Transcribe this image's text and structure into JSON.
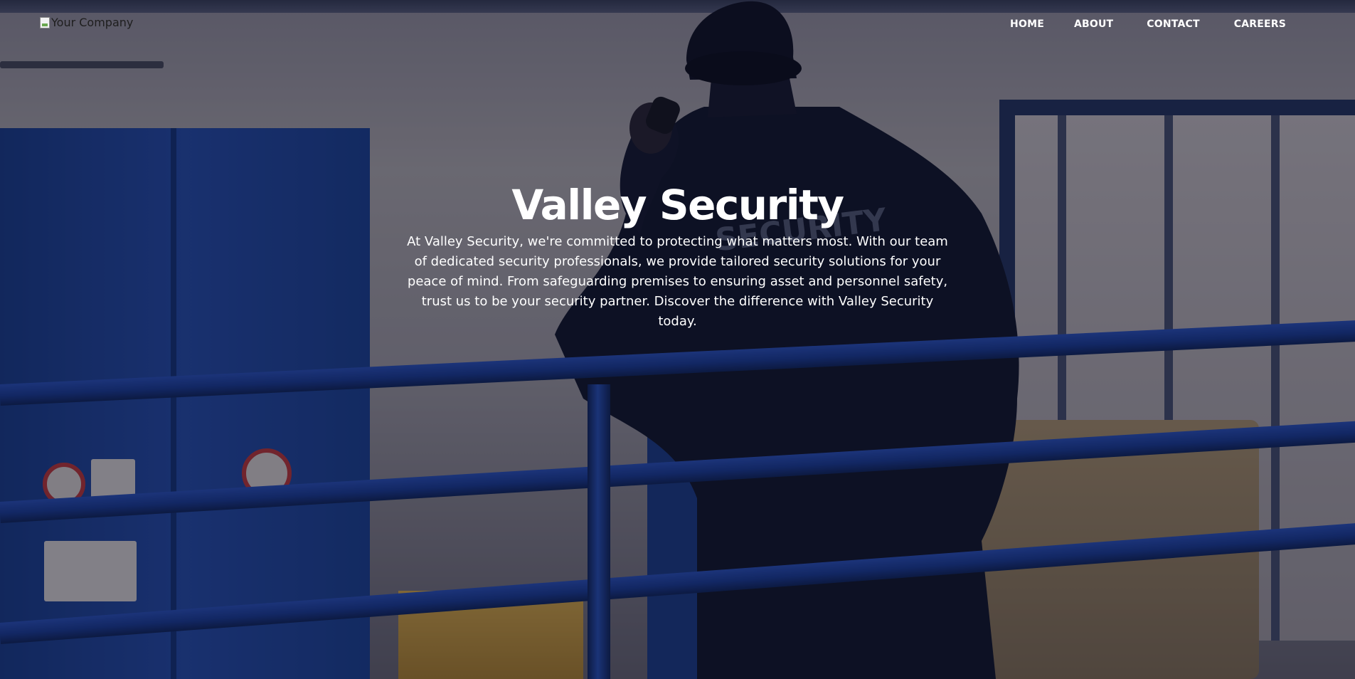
{
  "header": {
    "logo_alt": "Your Company",
    "nav": [
      "HOME",
      "ABOUT",
      "CONTACT",
      "CAREERS"
    ]
  },
  "hero": {
    "title": "Valley Security",
    "description": "At Valley Security, we're committed to protecting what matters most. With our team of dedicated security professionals, we provide tailored security solutions for your peace of mind. From safeguarding premises to ensuring asset and personnel safety, trust us to be your security partner. Discover the difference with Valley Security today.",
    "jacket_print": "SECURITY"
  },
  "colors": {
    "nav_text": "#ffffff",
    "hero_text": "#ffffff",
    "overlay": "rgba(8,10,30,0.45)",
    "railing_blue": "#1b3f9c"
  }
}
